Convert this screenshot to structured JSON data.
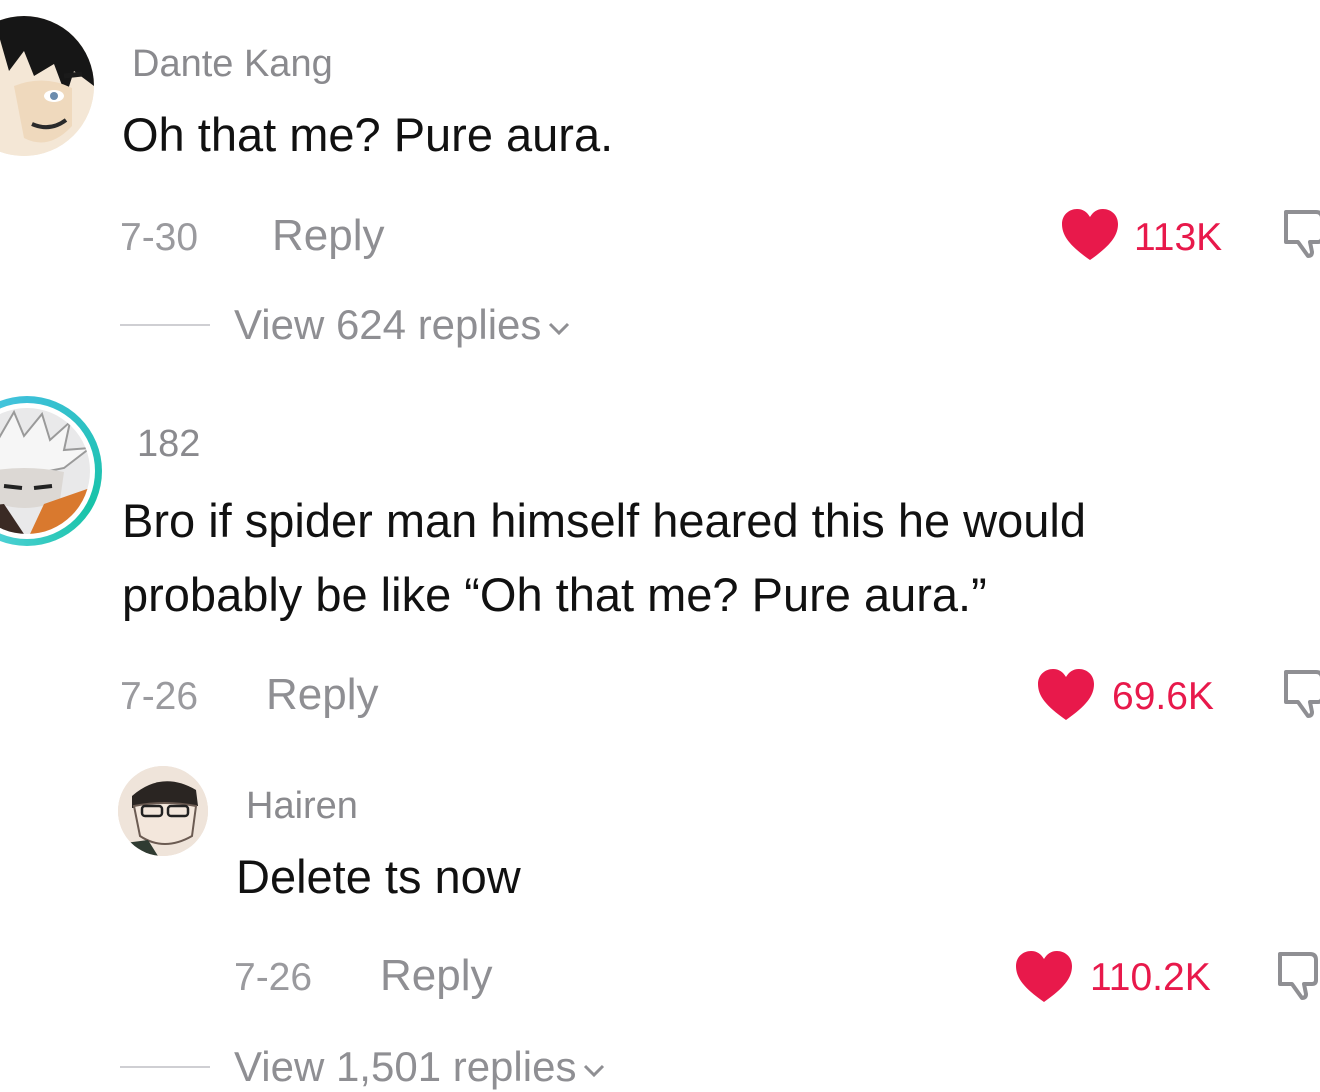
{
  "colors": {
    "like_red": "#e8194b",
    "secondary_text": "#8f8f93",
    "primary_text": "#111111"
  },
  "comments": [
    {
      "username": "Dante Kang",
      "text_lines": [
        "Oh that me? Pure aura."
      ],
      "date": "7-30",
      "reply_label": "Reply",
      "likes": "113K",
      "view_replies": "View 624 replies",
      "avatar_icon": "anime-avatar-dark-hair"
    },
    {
      "username": "182",
      "text_lines": [
        "Bro if spider man himself heared this he would",
        "probably be like “Oh that me? Pure aura.”"
      ],
      "date": "7-26",
      "reply_label": "Reply",
      "likes": "69.6K",
      "avatar_icon": "anime-avatar-white-hair"
    },
    {
      "username": "Hairen",
      "text_lines": [
        "Delete ts now"
      ],
      "date": "7-26",
      "reply_label": "Reply",
      "likes": "110.2K",
      "view_replies": "View 1,501 replies",
      "avatar_icon": "anime-avatar-glasses"
    }
  ]
}
